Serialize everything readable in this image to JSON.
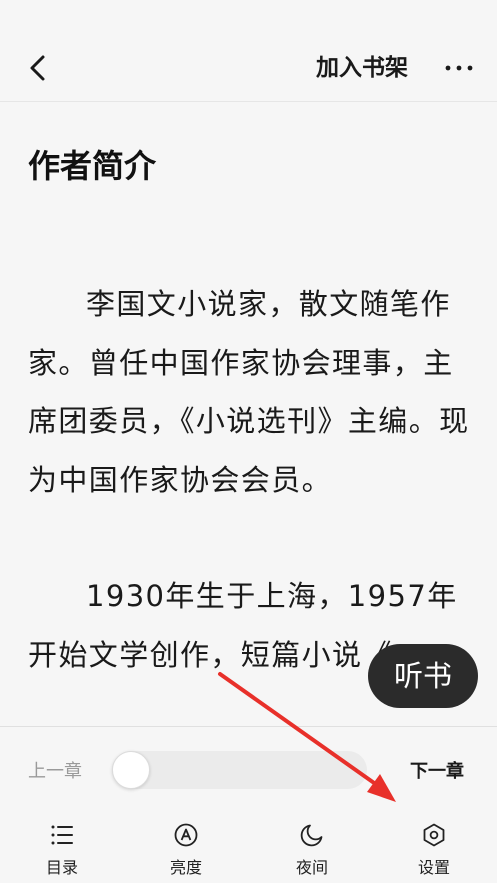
{
  "header": {
    "add_to_shelf": "加入书架"
  },
  "content": {
    "chapter_title": "作者简介",
    "paragraphs": [
      "李国文小说家，散文随笔作家。曾任中国作家协会理事，主席团委员，《小说选刊》主编。现为中国作家协会会员。",
      "1930年生于上海，1957年开始文学创作，短篇小说《"
    ]
  },
  "listen_button": {
    "label": "听书"
  },
  "reader_controls": {
    "prev_chapter": "上一章",
    "next_chapter": "下一章",
    "progress": 0
  },
  "bottom_nav": {
    "catalog": "目录",
    "brightness": "亮度",
    "night": "夜间",
    "settings": "设置"
  },
  "colors": {
    "background": "#f6f6f6",
    "text": "#1a1a1a",
    "listen_button_bg": "#2b2b2b",
    "annotation_arrow": "#e8302a"
  }
}
